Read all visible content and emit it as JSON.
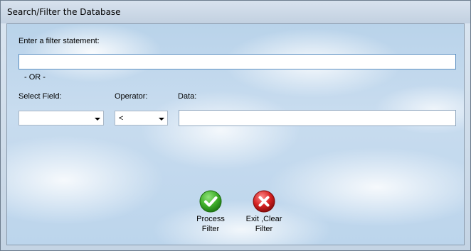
{
  "window": {
    "title": "Search/Filter the Database"
  },
  "form": {
    "filter_label": "Enter a filter statement:",
    "filter_value": "",
    "or_label": "- OR -",
    "field_label": "Select Field:",
    "field_value": "",
    "operator_label": "Operator:",
    "operator_value": "<",
    "data_label": "Data:",
    "data_value": ""
  },
  "buttons": {
    "process_line1": "Process",
    "process_line2": "Filter",
    "exit_line1": "Exit ,Clear",
    "exit_line2": "Filter"
  },
  "colors": {
    "process": "#3fae2a",
    "exit": "#d42020"
  }
}
